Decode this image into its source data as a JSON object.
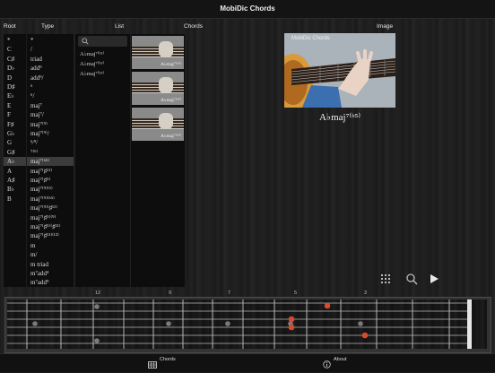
{
  "header": {
    "title": "MobiDic Chords"
  },
  "columns": {
    "root": "Root",
    "type": "Type",
    "list": "List",
    "chords": "Chords",
    "image": "Image"
  },
  "roots": [
    "*",
    "C",
    "C♯",
    "D♭",
    "D",
    "D♯",
    "E♭",
    "E",
    "F",
    "F♯",
    "G♭",
    "G",
    "G♯",
    "A♭",
    "A",
    "A♯",
    "B♭",
    "B"
  ],
  "types": [
    "*",
    "/",
    " triad",
    "add⁹",
    "add⁹/",
    "⁶",
    "⁶/",
    "maj⁷",
    "maj⁷/",
    "maj⁷⁽⁹⁾",
    "maj⁷⁽⁹⁾/",
    "⁶⁄⁹/",
    "⁷⁽⁶⁾",
    "maj⁷⁽ᵇ⁵⁾",
    "maj⁷⁽♯¹¹⁾",
    "maj⁷⁽♯⁵⁾",
    "maj⁷⁽⁹⁾⁽⁶⁾",
    "maj⁷⁽⁹⁾⁽ᵇ⁵⁾",
    "maj⁷⁽⁹⁾⁽♯¹¹⁾",
    "maj⁷⁽♯⁵⁾⁽⁹⁾",
    "maj⁷⁽♯⁵⁾⁽♯¹¹⁾",
    "maj⁷⁽♯¹¹⁾⁽¹³⁾",
    "m",
    "m/",
    "m triad",
    "m⁷add⁴",
    "m⁷add⁹"
  ],
  "selected": {
    "root_index": 13,
    "type_index": 13
  },
  "search": {
    "placeholder": ""
  },
  "list_items": [
    "A♭maj⁷⁽ᵇ⁵⁾",
    "A♭maj⁷⁽ᵇ⁵⁾",
    "A♭maj⁷⁽ᵇ⁵⁾"
  ],
  "chord_thumbs": [
    "A♭maj⁷⁽ᵇ⁵⁾",
    "A♭maj⁷⁽ᵇ⁵⁾",
    "A♭maj⁷⁽ᵇ⁵⁾"
  ],
  "image": {
    "watermark": "MobiDic Chords",
    "caption": "A♭maj⁷⁽ᵇ⁵⁾"
  },
  "toolbar": {
    "icons": [
      "grid-icon",
      "search-icon",
      "play-icon"
    ]
  },
  "fretboard": {
    "fret_numbers": [
      "12",
      "9",
      "7",
      "5",
      "3"
    ],
    "strings": 6,
    "frets": 15,
    "active_notes": 4
  },
  "tabbar": {
    "chords_label": "Chords",
    "about_label": "About"
  }
}
